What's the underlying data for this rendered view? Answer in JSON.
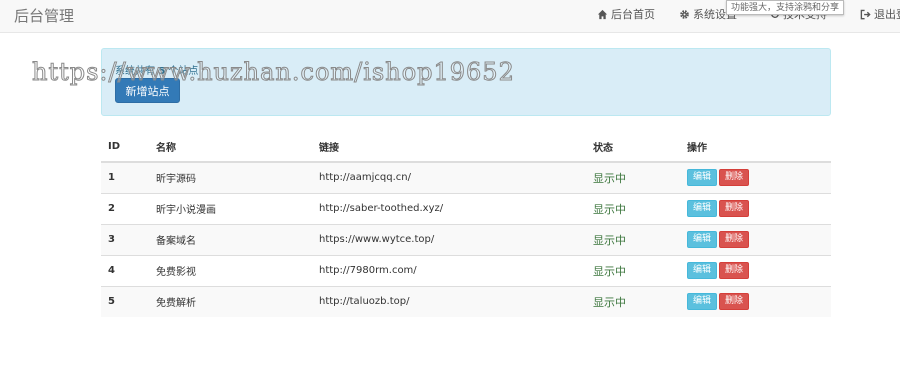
{
  "navbar": {
    "brand": "后台管理",
    "home_label": "后台首页",
    "settings_label": "系统设置",
    "support_label": "技术支持",
    "logout_label": "退出登",
    "tooltip": "功能强大，支持涂鸦和分享"
  },
  "alert": {
    "prefix": "系统共有",
    "count": "5",
    "suffix": "个站点",
    "add_button": "新增站点"
  },
  "watermark": "https://www.huzhan.com/ishop19652",
  "table": {
    "headers": [
      "ID",
      "名称",
      "链接",
      "状态",
      "操作"
    ],
    "edit_label": "编辑",
    "delete_label": "删除",
    "rows": [
      {
        "id": "1",
        "name": "昕宇源码",
        "link": "http://aamjcqq.cn/",
        "status": "显示中"
      },
      {
        "id": "2",
        "name": "昕宇小说漫画",
        "link": "http://saber-toothed.xyz/",
        "status": "显示中"
      },
      {
        "id": "3",
        "name": "备案域名",
        "link": "https://www.wytce.top/",
        "status": "显示中"
      },
      {
        "id": "4",
        "name": "免费影视",
        "link": "http://7980rm.com/",
        "status": "显示中"
      },
      {
        "id": "5",
        "name": "免费解析",
        "link": "http://taluozb.top/",
        "status": "显示中"
      }
    ]
  },
  "colors": {
    "primary": "#337ab7",
    "info": "#5bc0de",
    "danger": "#d9534f",
    "success_text": "#3c763d",
    "alert_bg": "#d9edf7"
  },
  "icons": [
    "home-icon",
    "gear-icon",
    "refresh-icon",
    "logout-icon"
  ]
}
